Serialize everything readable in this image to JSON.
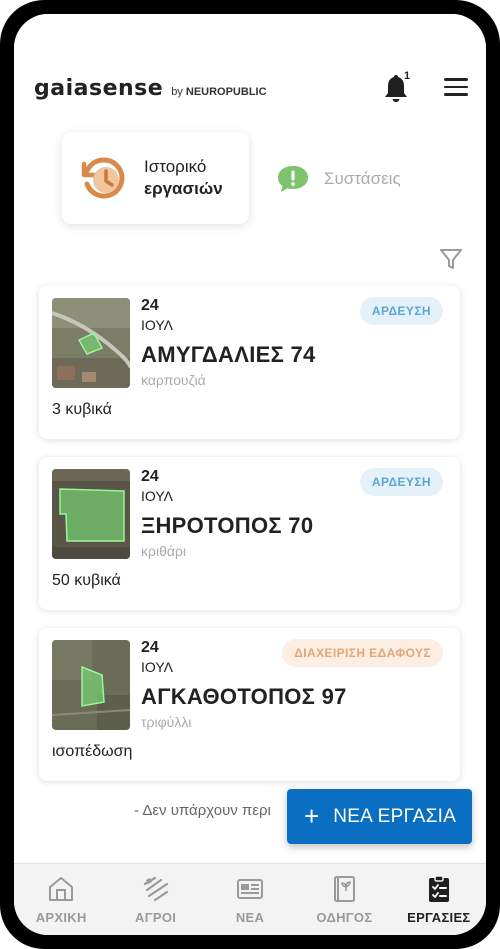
{
  "header": {
    "brand_name": "gaiasense",
    "brand_by": "by",
    "brand_company": "NEUROPUBLIC",
    "notification_count": "1"
  },
  "tabs": {
    "history_line1": "Ιστορικό",
    "history_line2": "εργασιών",
    "recommendations": "Συστάσεις"
  },
  "tasks": [
    {
      "day": "24",
      "month": "ΙΟΥΛ",
      "title": "ΑΜΥΓΔΑΛΙΕΣ 74",
      "crop": "καρπουζιά",
      "note": "3 κυβικά",
      "badge": "ΑΡΔΕΥΣΗ"
    },
    {
      "day": "24",
      "month": "ΙΟΥΛ",
      "title": "ΞΗΡΟΤΟΠΟΣ 70",
      "crop": "κριθάρι",
      "note": "50 κυβικά",
      "badge": "ΑΡΔΕΥΣΗ"
    },
    {
      "day": "24",
      "month": "ΙΟΥΛ",
      "title": "ΑΓΚΑΘΟΤΟΠΟΣ 97",
      "crop": "τριφύλλι",
      "note": "ισοπέδωση",
      "badge": "ΔΙΑΧΕΙΡΙΣΗ ΕΔΑΦΟΥΣ"
    }
  ],
  "footer_text": "- Δεν υπάρχουν περι",
  "fab": {
    "plus": "+",
    "label": "ΝΕΑ ΕΡΓΑΣΙΑ"
  },
  "nav": [
    {
      "label": "ΑΡΧΙΚΗ",
      "icon": "home-icon"
    },
    {
      "label": "ΑΓΡΟΙ",
      "icon": "fields-icon"
    },
    {
      "label": "ΝΕΑ",
      "icon": "news-icon"
    },
    {
      "label": "ΟΔΗΓΟΣ",
      "icon": "guide-icon"
    },
    {
      "label": "ΕΡΓΑΣΙΕΣ",
      "icon": "tasks-icon"
    }
  ],
  "colors": {
    "accent": "#0a6fc2",
    "irrigation_badge_text": "#5aa6d6",
    "soil_badge_text": "#e4a578",
    "history_icon": "#d98a4a",
    "recommendation_icon": "#7cc36b"
  }
}
